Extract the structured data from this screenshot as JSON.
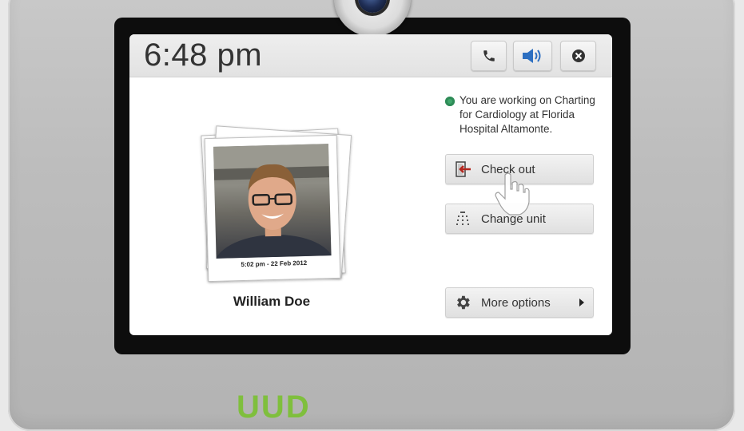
{
  "topbar": {
    "time": "6:48 pm",
    "buttons": [
      {
        "icon": "phone-icon"
      },
      {
        "icon": "speaker-icon"
      },
      {
        "icon": "close-icon"
      }
    ]
  },
  "profile": {
    "name": "William Doe",
    "photo_caption": "5:02 pm - 22 Feb 2012"
  },
  "status": {
    "message": "You are working on Charting for Cardiology at Florida Hospital Altamonte.",
    "color": "#3fa66b"
  },
  "actions": {
    "check_out": "Check out",
    "change_unit": "Change unit",
    "more_options": "More options"
  },
  "brand": {
    "text": "UUD",
    "color": "#7fbf3d"
  }
}
